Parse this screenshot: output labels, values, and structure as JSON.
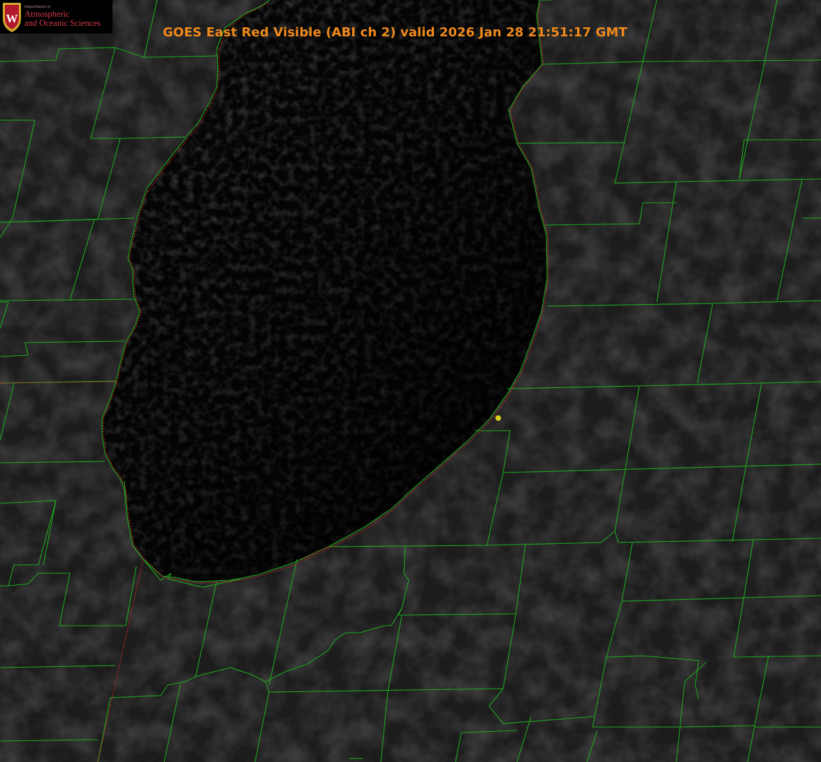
{
  "logo": {
    "department": "Department of",
    "line1": "Atmospheric",
    "line2": "and Oceanic Sciences",
    "crest_letter": "W"
  },
  "title": "GOES East Red Visible (ABI ch 2) valid 2026 Jan 28 21:51:17 GMT",
  "colors": {
    "title": "#f08a1c",
    "county_lines": "#1fa81f",
    "state_lines": "#d12a2a",
    "marker": "#d8d21e",
    "land": "#1c1c1c",
    "lake": "#070707"
  },
  "icons": {
    "crest": "uw-crest-icon",
    "marker": "site-marker-icon"
  }
}
